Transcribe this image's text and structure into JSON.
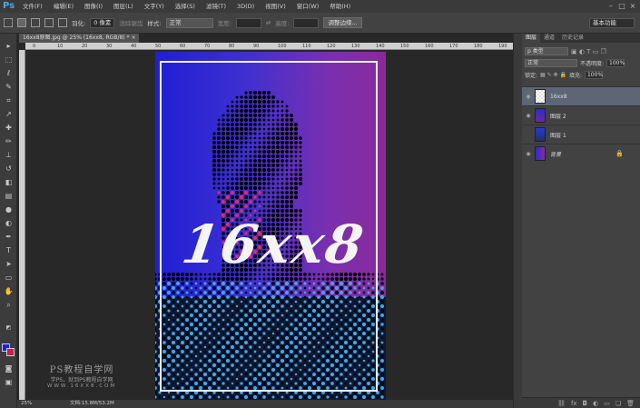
{
  "app": {
    "logo": "Ps"
  },
  "menu": [
    "文件(F)",
    "编辑(E)",
    "图像(I)",
    "图层(L)",
    "文字(Y)",
    "选择(S)",
    "滤镜(T)",
    "3D(D)",
    "视图(V)",
    "窗口(W)",
    "帮助(H)"
  ],
  "window_controls": [
    "–",
    "□",
    "×"
  ],
  "options": {
    "feather_label": "羽化:",
    "feather_value": "0 像素",
    "antialias_label": "消除锯齿",
    "style_label": "样式:",
    "style_value": "正常",
    "width_label": "宽度:",
    "height_label": "高度:",
    "refine_button": "调整边缘...",
    "workspace": "基本功能"
  },
  "document_tab": "16xx8原图.jpg @ 25% (16xx8, RGB/8) *  ×",
  "ruler_h": [
    "0",
    "10",
    "20",
    "30",
    "40",
    "50",
    "60",
    "70",
    "80",
    "90",
    "100",
    "110",
    "120",
    "130",
    "140",
    "150",
    "160",
    "170",
    "180",
    "190"
  ],
  "canvas_text": "16xx8",
  "status": {
    "zoom": "25%",
    "doc": "文档:15.8M/53.2M"
  },
  "watermark": {
    "line1": "PS教程自学网",
    "line2": "学PS，就到PS教程自学网",
    "line3": "WWW.16XX8.COM"
  },
  "layers_panel": {
    "tabs": [
      "图层",
      "通道",
      "历史记录"
    ],
    "kind_filter": "p 类型",
    "blend_mode": "正常",
    "opacity_label": "不透明度:",
    "opacity_value": "100%",
    "lock_label": "锁定:",
    "fill_label": "填充:",
    "fill_value": "100%",
    "layers": [
      {
        "name": "16xx8",
        "visible": true,
        "selected": true
      },
      {
        "name": "图层 2",
        "visible": true,
        "selected": false
      },
      {
        "name": "图层 1",
        "visible": false,
        "selected": false
      },
      {
        "name": "背景",
        "visible": true,
        "selected": false
      }
    ]
  },
  "colors": {
    "foreground": "#1a1ee8",
    "background": "#c8204a",
    "accent": "#4fa3e0"
  }
}
